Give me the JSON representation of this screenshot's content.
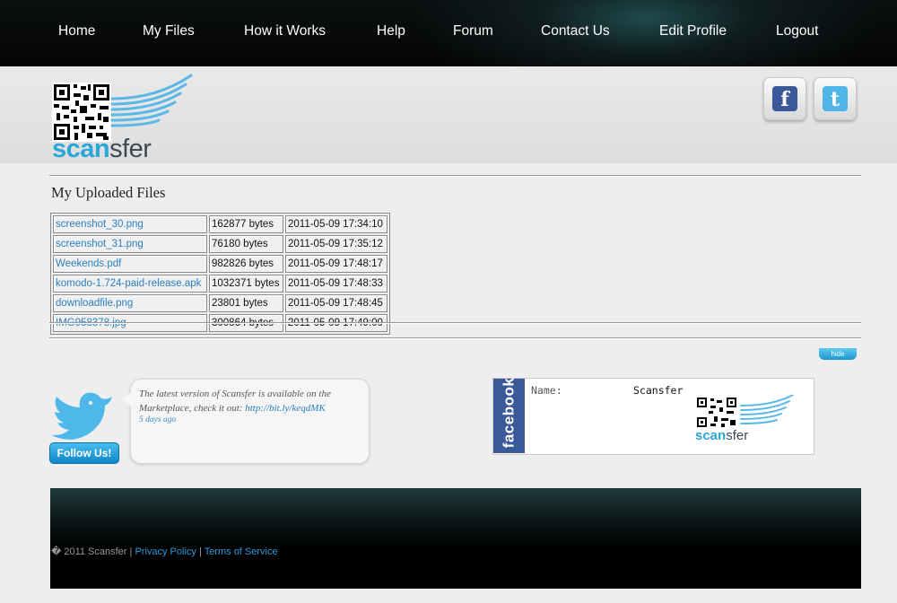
{
  "nav": {
    "items": [
      "Home",
      "My Files",
      "How it Works",
      "Help",
      "Forum",
      "Contact Us",
      "Edit Profile",
      "Logout"
    ]
  },
  "logo": {
    "part1": "scan",
    "part2": "sfer"
  },
  "social": {
    "facebook_icon": "f",
    "twitter_icon": "t"
  },
  "files": {
    "title": "My Uploaded Files",
    "rows": [
      {
        "name": "screenshot_30.png",
        "size": "162877 bytes",
        "date": "2011-05-09 17:34:10"
      },
      {
        "name": "screenshot_31.png",
        "size": "76180 bytes",
        "date": "2011-05-09 17:35:12"
      },
      {
        "name": "Weekends.pdf",
        "size": "982826 bytes",
        "date": "2011-05-09 17:48:17"
      },
      {
        "name": "komodo-1.724-paid-release.apk",
        "size": "1032371 bytes",
        "date": "2011-05-09 17:48:33"
      },
      {
        "name": "downloadfile.png",
        "size": "23801 bytes",
        "date": "2011-05-09 17:48:45"
      },
      {
        "name": "IMG958378.jpg",
        "size": "300864 bytes",
        "date": "2011-05-09 17:49:00"
      }
    ]
  },
  "hide_label": "hide",
  "twitter": {
    "follow_label": "Follow Us!",
    "tweet_text": "The latest version of Scansfer is available on the Marketplace, check it out: ",
    "tweet_link": "http://bit.ly/keqdMK",
    "tweet_time": "5 days ago"
  },
  "facebook_card": {
    "bar_label": "facebook",
    "name_label": "Name:",
    "name_value": "Scansfer",
    "logo_part1": "scan",
    "logo_part2": "sfer"
  },
  "footer": {
    "copyright": "� 2011 Scansfer | ",
    "privacy": "Privacy Policy",
    "sep": " | ",
    "terms": "Terms of Service"
  },
  "colors": {
    "accent": "#2aa6d8",
    "link": "#2a7fc0",
    "facebook": "#3b5998"
  }
}
